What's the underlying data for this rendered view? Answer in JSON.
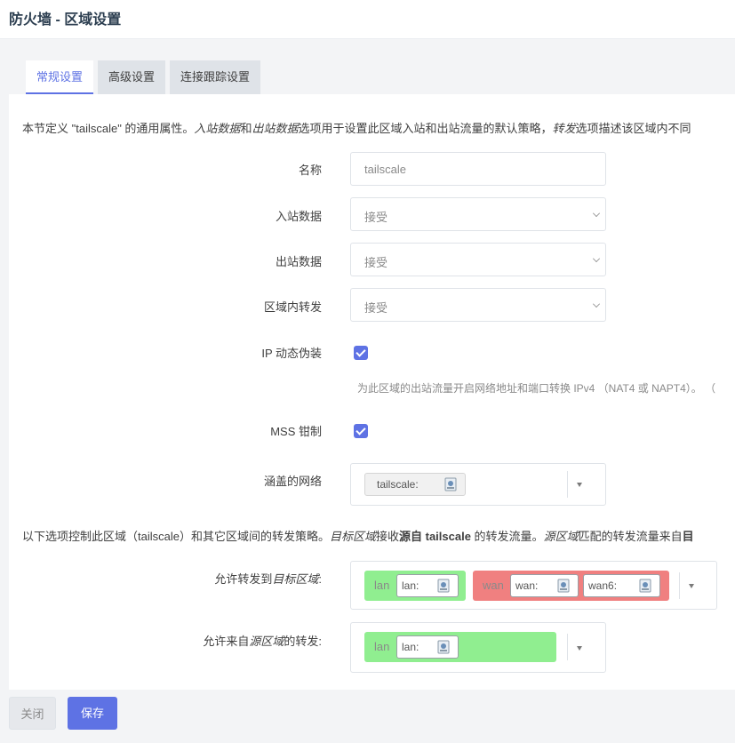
{
  "header": {
    "title": "防火墙 - 区域设置"
  },
  "tabs": [
    {
      "label": "常规设置",
      "active": true
    },
    {
      "label": "高级设置",
      "active": false
    },
    {
      "label": "连接跟踪设置",
      "active": false
    }
  ],
  "general": {
    "desc": {
      "p1": "本节定义 \"tailscale\" 的通用属性。",
      "i1": "入站数据",
      "p2": "和",
      "i2": "出站数据",
      "p3": "选项用于设置此区域入站和出站流量的默认策略，",
      "i3": "转发",
      "p4": "选项描述该区域内不同"
    },
    "name": {
      "label": "名称",
      "value": "tailscale"
    },
    "input": {
      "label": "入站数据",
      "value": "接受"
    },
    "output": {
      "label": "出站数据",
      "value": "接受"
    },
    "forward": {
      "label": "区域内转发",
      "value": "接受"
    },
    "masq": {
      "label": "IP 动态伪装",
      "help": "为此区域的出站流量开启网络地址和端口转换 IPv4 （NAT4 或 NAPT4）。 （"
    },
    "mss": {
      "label": "MSS 钳制"
    },
    "networks": {
      "label": "涵盖的网络",
      "items": [
        {
          "label": "tailscale:"
        }
      ]
    }
  },
  "forwarding": {
    "desc": {
      "p1": "以下选项控制此区域（tailscale）和其它区域间的转发策略。",
      "i1": "目标区域",
      "p2": "接收",
      "b1": "源自 tailscale",
      "p3": " 的转发流量。",
      "i2": "源区域",
      "p4": "匹配的转发流量来自",
      "b2": "目"
    },
    "dest": {
      "label_prefix": "允许转发到",
      "label_italic": "目标区域",
      "label_suffix": ":",
      "zones": [
        {
          "name": "lan",
          "color": "#90ee90",
          "networks": [
            "lan:"
          ]
        },
        {
          "name": "wan",
          "color": "#f08080",
          "networks": [
            "wan:",
            "wan6:"
          ]
        }
      ]
    },
    "src": {
      "label_prefix": "允许来自",
      "label_italic": "源区域",
      "label_suffix": "的转发:",
      "zones": [
        {
          "name": "lan",
          "color": "#90ee90",
          "networks": [
            "lan:"
          ]
        }
      ]
    }
  },
  "footer": {
    "close_label": "关闭",
    "save_label": "保存"
  },
  "accent_color": "#5e72e4"
}
